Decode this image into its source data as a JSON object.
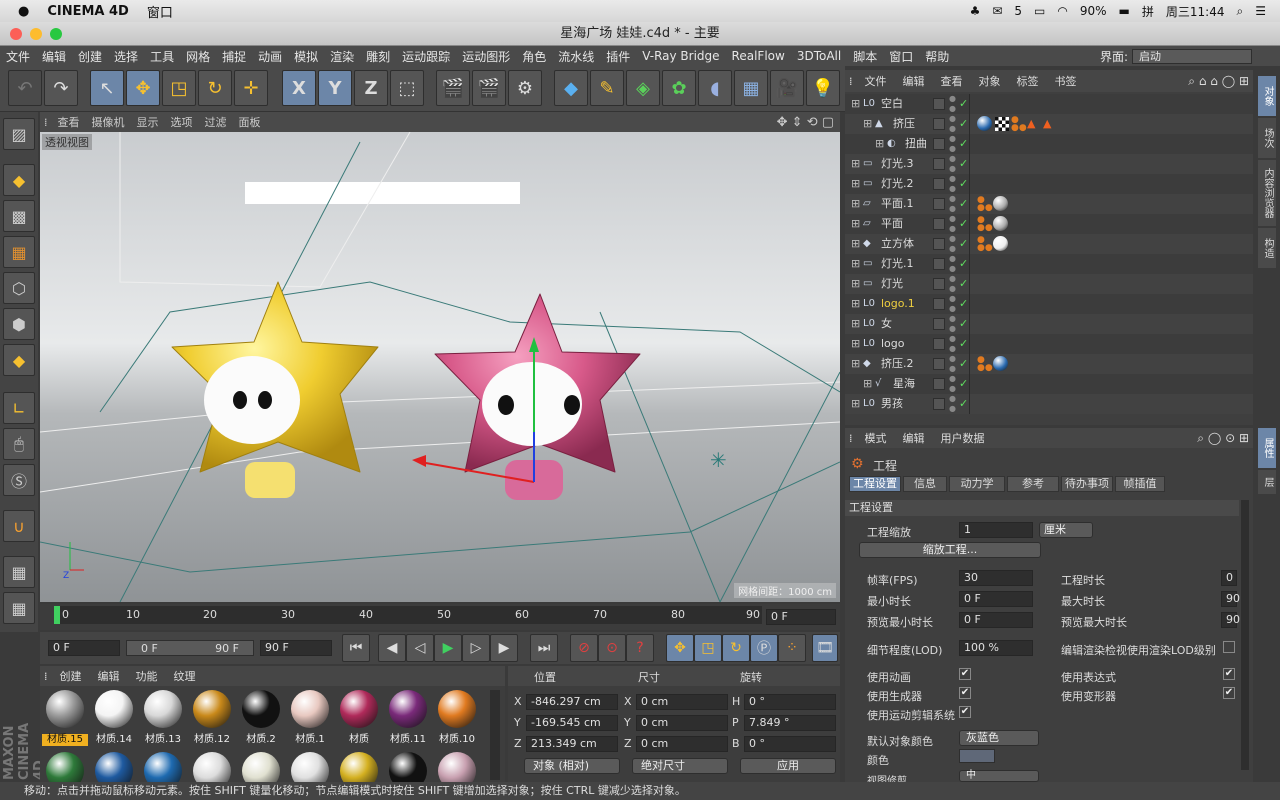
{
  "mac": {
    "app": "CINEMA 4D",
    "menu": "窗口",
    "wechat_count": "5",
    "battery": "90%",
    "clock": "周三11:44"
  },
  "window": {
    "title": "星海广场 娃娃.c4d * - 主要"
  },
  "menubar": [
    "文件",
    "编辑",
    "创建",
    "选择",
    "工具",
    "网格",
    "捕捉",
    "动画",
    "模拟",
    "渲染",
    "雕刻",
    "运动跟踪",
    "运动图形",
    "角色",
    "流水线",
    "插件",
    "V-Ray Bridge",
    "RealFlow",
    "3DToAll",
    "脚本",
    "窗口",
    "帮助"
  ],
  "layout": {
    "label": "界面:",
    "value": "启动"
  },
  "toolbar": {
    "x": "X",
    "y": "Y",
    "z": "Z"
  },
  "viewport": {
    "menu": [
      "查看",
      "摄像机",
      "显示",
      "选项",
      "过滤",
      "面板"
    ],
    "label": "透视视图",
    "grid_info": "网格间距：1000 cm"
  },
  "timeline": {
    "ticks": [
      "0",
      "10",
      "20",
      "30",
      "40",
      "50",
      "60",
      "70",
      "80",
      "90"
    ],
    "current": "0 F"
  },
  "playback": {
    "start": "0 F",
    "min": "0 F",
    "max": "90 F",
    "end": "90 F"
  },
  "materials": {
    "menu": [
      "创建",
      "编辑",
      "功能",
      "纹理"
    ],
    "items": [
      {
        "name": "材质.15",
        "color": "#9a9a9a",
        "sel": true
      },
      {
        "name": "材质.14",
        "color": "#f4f4f4"
      },
      {
        "name": "材质.13",
        "color": "#d8d8d8"
      },
      {
        "name": "材质.12",
        "color": "#c9891a"
      },
      {
        "name": "材质.2",
        "color": "#111111"
      },
      {
        "name": "材质.1",
        "color": "#e8c8c0"
      },
      {
        "name": "材质",
        "color": "#b02a5a"
      },
      {
        "name": "材质.11",
        "color": "#7a2a7a"
      },
      {
        "name": "材质.10",
        "color": "#e07a20"
      }
    ],
    "row2": [
      "#2e7a3a",
      "#1e5aa0",
      "#1e6ab0",
      "#dcdcdc",
      "#e0e0d0",
      "#e0e0e0",
      "#d4b020",
      "#111111",
      "#c8a0b0"
    ]
  },
  "coords": {
    "headers": [
      "位置",
      "尺寸",
      "旋转"
    ],
    "rows": [
      {
        "a": "X",
        "av": "-846.297 cm",
        "b": "X",
        "bv": "0 cm",
        "c": "H",
        "cv": "0 °"
      },
      {
        "a": "Y",
        "av": "-169.545 cm",
        "b": "Y",
        "bv": "0 cm",
        "c": "P",
        "cv": "7.849 °"
      },
      {
        "a": "Z",
        "av": "213.349 cm",
        "b": "Z",
        "bv": "0 cm",
        "c": "B",
        "cv": "0 °"
      }
    ],
    "mode1": "对象 (相对)",
    "mode2": "绝对尺寸",
    "apply": "应用"
  },
  "objects": {
    "menu": [
      "文件",
      "编辑",
      "查看",
      "对象",
      "标签",
      "书签"
    ],
    "items": [
      {
        "name": "空白",
        "indent": 0,
        "icon": "L0",
        "tags": []
      },
      {
        "name": "挤压",
        "indent": 1,
        "icon": "▲",
        "tags": [
          "#2a6ab0",
          "checker",
          "o",
          "t",
          "t"
        ]
      },
      {
        "name": "扭曲",
        "indent": 2,
        "icon": "◐",
        "tags": []
      },
      {
        "name": "灯光.3",
        "indent": 0,
        "icon": "▭",
        "tags": []
      },
      {
        "name": "灯光.2",
        "indent": 0,
        "icon": "▭",
        "tags": []
      },
      {
        "name": "平面.1",
        "indent": 0,
        "icon": "▱",
        "tags": [
          "o",
          "#aaaaaa"
        ]
      },
      {
        "name": "平面",
        "indent": 0,
        "icon": "▱",
        "tags": [
          "o",
          "#aaaaaa"
        ]
      },
      {
        "name": "立方体",
        "indent": 0,
        "icon": "◆",
        "tags": [
          "o",
          "#eeeeee"
        ]
      },
      {
        "name": "灯光.1",
        "indent": 0,
        "icon": "▭",
        "tags": []
      },
      {
        "name": "灯光",
        "indent": 0,
        "icon": "▭",
        "tags": []
      },
      {
        "name": "logo.1",
        "indent": 0,
        "icon": "L0",
        "tags": [],
        "hl": true
      },
      {
        "name": "女",
        "indent": 0,
        "icon": "L0",
        "tags": []
      },
      {
        "name": "logo",
        "indent": 0,
        "icon": "L0",
        "tags": []
      },
      {
        "name": "挤压.2",
        "indent": 0,
        "icon": "◆",
        "tags": [
          "o",
          "#2a6ab0"
        ]
      },
      {
        "name": "星海",
        "indent": 1,
        "icon": "√",
        "tags": []
      },
      {
        "name": "男孩",
        "indent": 0,
        "icon": "L0",
        "tags": []
      }
    ]
  },
  "attributes": {
    "menu": [
      "模式",
      "编辑",
      "用户数据"
    ],
    "title": "工程",
    "tabs": [
      "工程设置",
      "信息",
      "动力学",
      "参考",
      "待办事项",
      "帧插值"
    ],
    "section": "工程设置",
    "scale_label": "工程缩放",
    "scale_value": "1",
    "scale_unit": "厘米",
    "scale_btn": "缩放工程...",
    "fps_label": "帧率(FPS)",
    "fps": "30",
    "duration_label": "工程时长",
    "duration": "0",
    "min_label": "最小时长",
    "min": "0 F",
    "max_label": "最大时长",
    "max": "90",
    "pmin_label": "预览最小时长",
    "pmin": "0 F",
    "pmax_label": "预览最大时长",
    "pmax": "90",
    "lod_label": "细节程度(LOD)",
    "lod": "100 %",
    "lod_render": "编辑渲染检视使用渲染LOD级别",
    "anim": "使用动画",
    "expr": "使用表达式",
    "gen": "使用生成器",
    "deform": "使用变形器",
    "motion": "使用运动剪辑系统",
    "objcolor_label": "默认对象颜色",
    "objcolor": "灰蓝色",
    "color_label": "颜色",
    "view_label": "视图修剪",
    "view_value": "中"
  },
  "rightstrip": [
    "对象",
    "场次",
    "内容浏览器",
    "构造",
    "属性",
    "层"
  ],
  "status": "移动：点击并拖动鼠标移动元素。按住 SHIFT 键量化移动；节点编辑模式时按住 SHIFT 键增加选择对象；按住 CTRL 键减少选择对象。"
}
